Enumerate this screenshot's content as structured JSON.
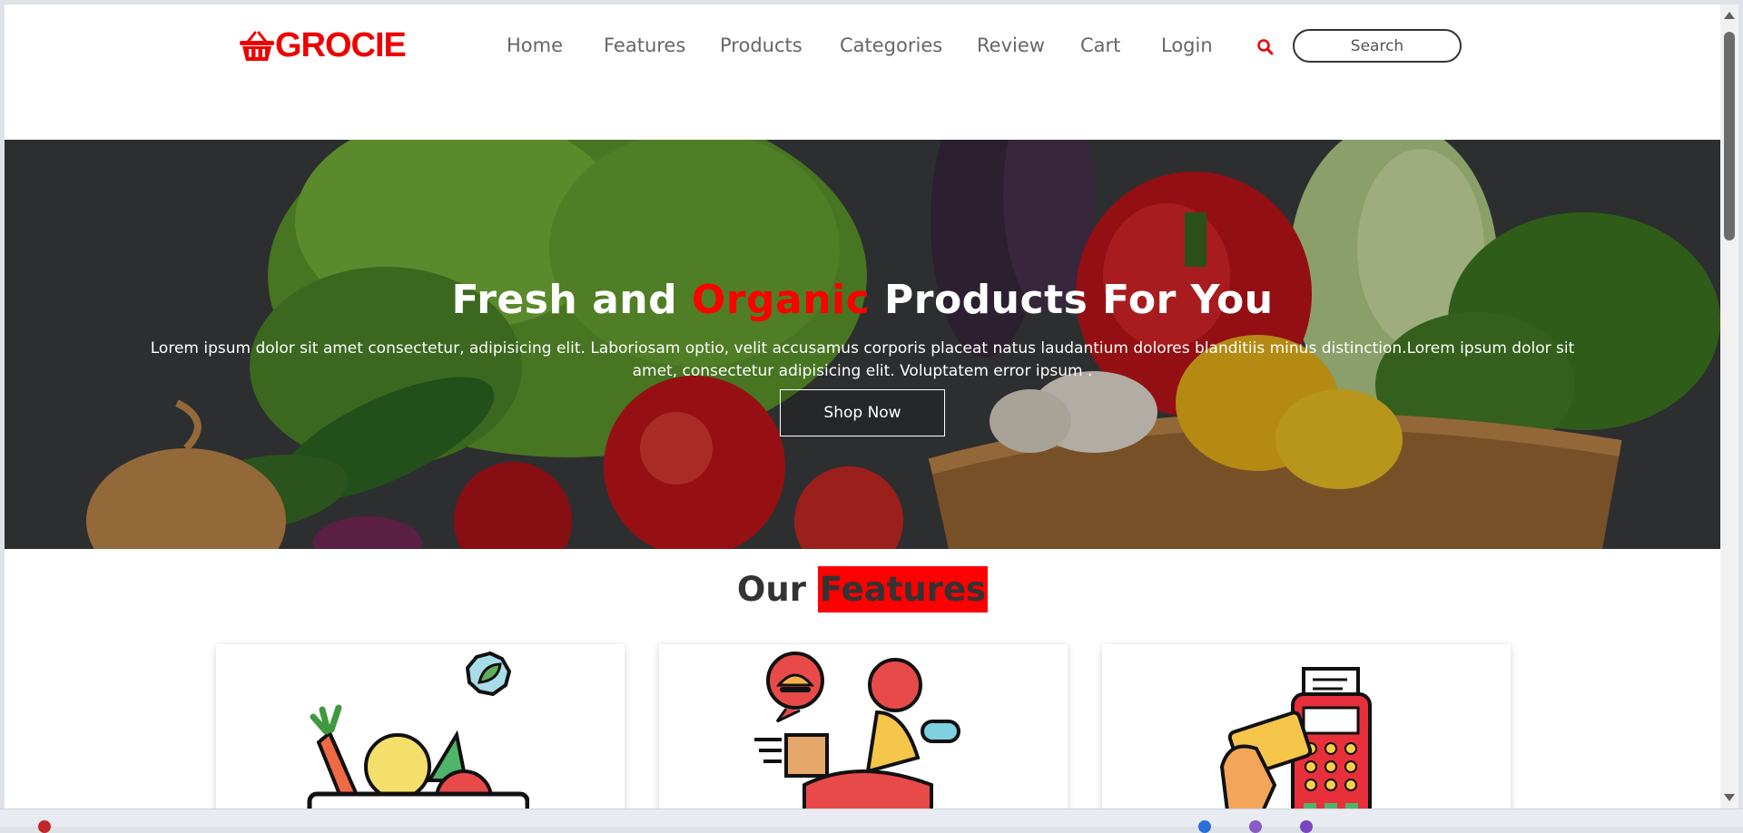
{
  "header": {
    "logo_text": "GROCIE",
    "nav": [
      "Home",
      "Features",
      "Products",
      "Categories",
      "Review",
      "Cart",
      "Login"
    ],
    "search_placeholder": "Search"
  },
  "hero": {
    "title_pre": "Fresh and ",
    "title_accent": "Organic",
    "title_post": " Products For You",
    "text": "Lorem ipsum dolor sit amet consectetur, adipisicing elit. Laboriosam optio, velit accusamus corporis placeat natus laudantium dolores blanditiis minus distinction.Lorem ipsum dolor sit amet, consectetur adipisicing elit. Voluptatem error ipsum .",
    "button": "Shop Now"
  },
  "features": {
    "heading_pre": "Our ",
    "heading_accent": "Features",
    "cards": [
      {
        "icon": "vegetable-basket-icon"
      },
      {
        "icon": "food-delivery-icon"
      },
      {
        "icon": "card-payment-icon"
      }
    ]
  },
  "colors": {
    "accent": "#ff0000",
    "text_dark": "#333333",
    "nav_text": "#666666"
  }
}
